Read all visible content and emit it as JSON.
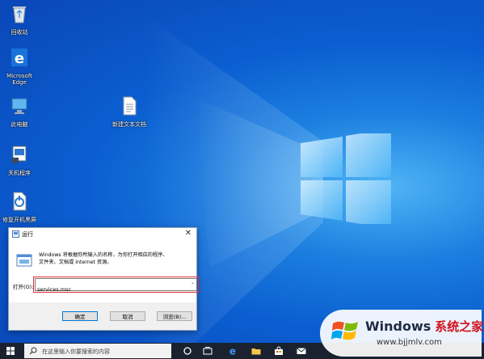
{
  "desktop": {
    "icons": [
      {
        "label": "回收站",
        "icon": "recycle-bin-icon"
      },
      {
        "label": "Microsoft Edge",
        "icon": "edge-icon"
      },
      {
        "label": "此电脑",
        "icon": "computer-icon"
      },
      {
        "label": "新建文本文档",
        "icon": "text-document-icon"
      },
      {
        "label": "关机程序",
        "icon": "shutdown-program-icon"
      },
      {
        "label": "修复开机黑屏",
        "icon": "repair-boot-icon"
      }
    ]
  },
  "run_dialog": {
    "title": "运行",
    "description_line1": "Windows 将根据你所输入的名称，为你打开相应的程序、",
    "description_line2": "文件夹、文档或 Internet 资源。",
    "open_label": "打开(O):",
    "command_value": "services.msc",
    "ok_label": "确定",
    "cancel_label": "取消",
    "browse_label": "浏览(B)...",
    "close_glyph": "✕"
  },
  "taskbar": {
    "search_placeholder": "在这里输入你要搜索的内容"
  },
  "watermark": {
    "brand": "Windows",
    "brand_cn": "系统之家",
    "url": "www.bjjmlv.com"
  },
  "colors": {
    "desktop_blue": "#0b5ed0",
    "highlight_red": "#e0303a",
    "taskbar": "#1a2230"
  }
}
